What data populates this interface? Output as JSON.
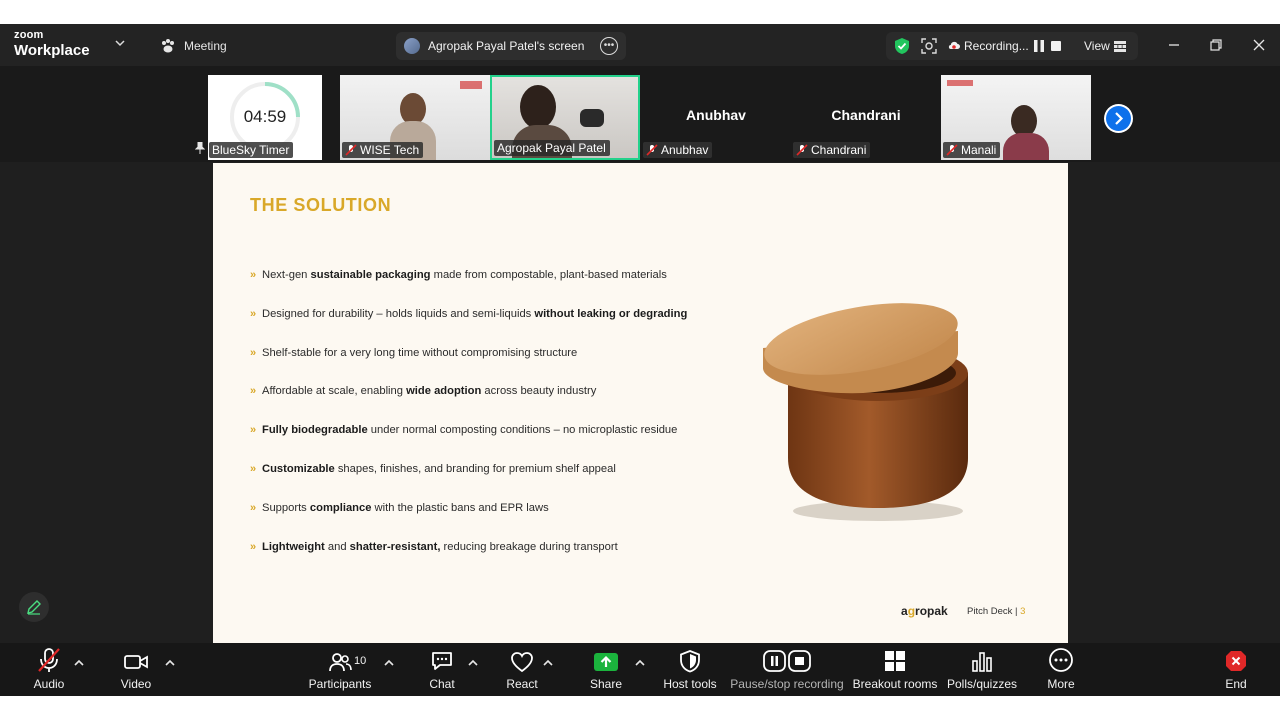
{
  "app": {
    "brand_small": "zoom",
    "brand_large": "Workplace"
  },
  "titlebar": {
    "meeting_label": "Meeting",
    "screen_share_label": "Agropak Payal Patel's screen",
    "recording_label": "Recording...",
    "view_label": "View"
  },
  "gallery": {
    "timer": {
      "value": "04:59",
      "name": "BlueSky Timer"
    },
    "tiles": [
      {
        "name": "WISE Tech"
      },
      {
        "name": "Agropak Payal Patel"
      },
      {
        "name": "Anubhav",
        "display_name": "Anubhav"
      },
      {
        "name": "Chandrani",
        "display_name": "Chandrani"
      },
      {
        "name": "Manali"
      }
    ]
  },
  "slide": {
    "title": "THE SOLUTION",
    "bullets": [
      {
        "pre": "Next-gen ",
        "bold": "sustainable packaging",
        "post": " made from compostable, plant-based materials"
      },
      {
        "pre": "Designed for durability – holds liquids and semi-liquids ",
        "bold": "without leaking or degrading",
        "post": ""
      },
      {
        "pre": "Shelf-stable for a very long time without compromising structure",
        "bold": "",
        "post": ""
      },
      {
        "pre": "Affordable at scale, enabling ",
        "bold": "wide adoption",
        "post": " across beauty industry"
      },
      {
        "pre": "",
        "bold": "Fully biodegradable",
        "post": " under normal composting conditions – no microplastic residue"
      },
      {
        "pre": "",
        "bold": "Customizable",
        "post": " shapes, finishes, and branding for premium shelf appeal"
      },
      {
        "pre": "Supports ",
        "bold": "compliance",
        "post": " with the plastic bans and EPR laws"
      },
      {
        "pre": "",
        "bold": "Lightweight",
        "post": " and ",
        "bold2": "shatter-resistant,",
        "post2": " reducing breakage during transport"
      }
    ],
    "bullet_mark": "»",
    "logo_a": "a",
    "logo_g": "g",
    "logo_rest": "ropak",
    "deck_label": "Pitch Deck | ",
    "deck_page": "3"
  },
  "toolbar": {
    "audio": "Audio",
    "video": "Video",
    "participants": "Participants",
    "participants_count": "10",
    "chat": "Chat",
    "react": "React",
    "share": "Share",
    "host_tools": "Host tools",
    "pause_stop_recording": "Pause/stop recording",
    "breakout_rooms": "Breakout rooms",
    "polls_quizzes": "Polls/quizzes",
    "more": "More",
    "end": "End"
  },
  "colors": {
    "accent_blue": "#0e71eb",
    "share_green": "#1bb33d",
    "mute_red": "#e02828",
    "slide_gold": "#d9a829",
    "speaker_border": "#23d18b"
  }
}
